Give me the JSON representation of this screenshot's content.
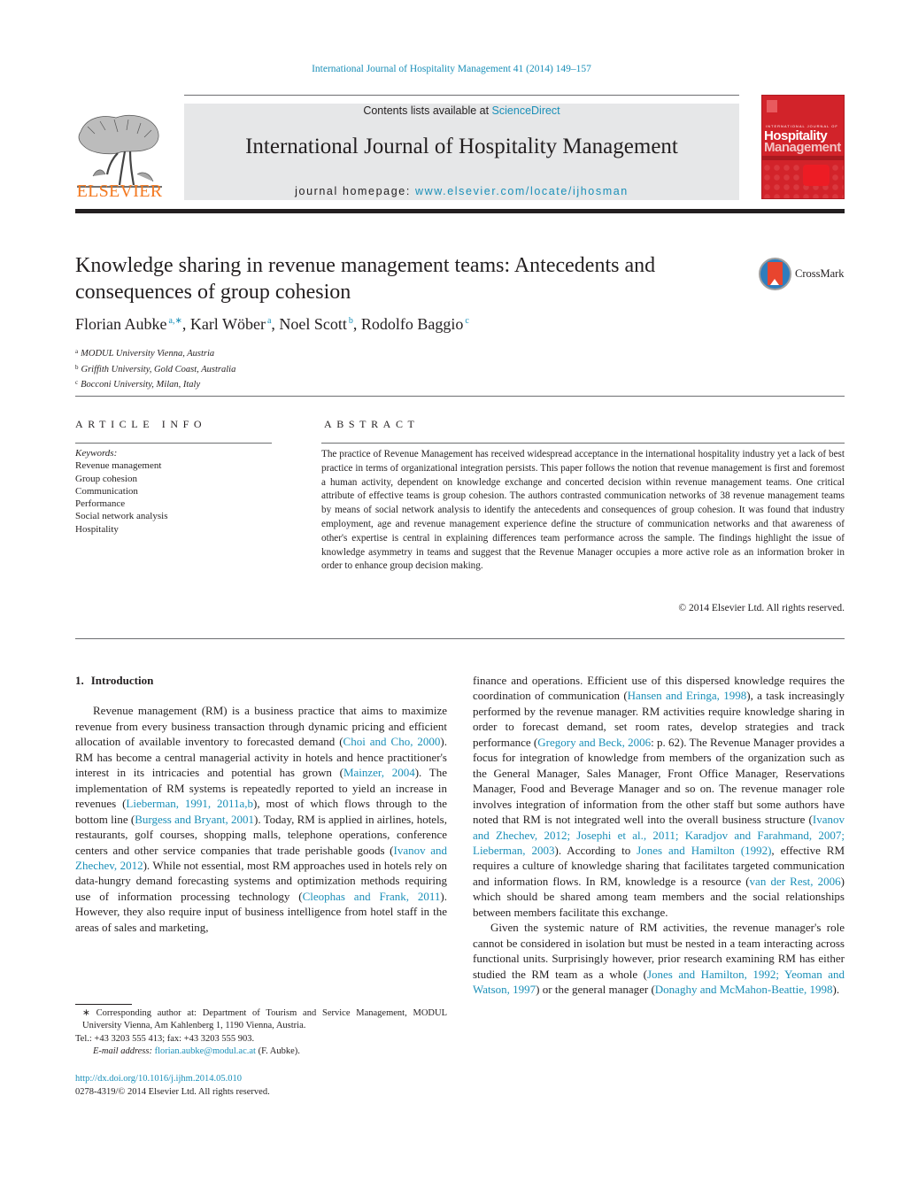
{
  "running_head": "International Journal of Hospitality Management 41 (2014) 149–157",
  "header": {
    "publisher_logo_text": "ELSEVIER",
    "contents_prefix": "Contents lists available at ",
    "contents_link": "ScienceDirect",
    "journal_title": "International Journal of Hospitality Management",
    "homepage_prefix": "journal homepage: ",
    "homepage_link": "www.elsevier.com/locate/ijhosman",
    "cover": {
      "small_line": "INTERNATIONAL JOURNAL OF",
      "big_line_1": "Hospitality",
      "big_line_2": "Management"
    }
  },
  "article": {
    "title": "Knowledge sharing in revenue management teams: Antecedents and consequences of group cohesion",
    "crossmark_label": "CrossMark",
    "authors": [
      {
        "name": "Florian Aubke",
        "sup": "a,∗"
      },
      {
        "name": "Karl Wöber",
        "sup": "a"
      },
      {
        "name": "Noel Scott",
        "sup": "b"
      },
      {
        "name": "Rodolfo Baggio",
        "sup": "c"
      }
    ],
    "affiliations": [
      {
        "key": "a",
        "text": "MODUL University Vienna, Austria"
      },
      {
        "key": "b",
        "text": "Griffith University, Gold Coast, Australia"
      },
      {
        "key": "c",
        "text": "Bocconi University, Milan, Italy"
      }
    ]
  },
  "article_info": {
    "heading": "ARTICLE INFO",
    "keywords_label": "Keywords:",
    "keywords": [
      "Revenue management",
      "Group cohesion",
      "Communication",
      "Performance",
      "Social network analysis",
      "Hospitality"
    ]
  },
  "abstract": {
    "heading": "ABSTRACT",
    "text": "The practice of Revenue Management has received widespread acceptance in the international hos­pitality industry yet a lack of best practice in terms of organizational integration persists. This paper follows the notion that revenue management is first and foremost a human activity, dependent on knowledge exchange and concerted decision within revenue management teams. One critical attribute of effective teams is group cohesion. The authors contrasted communication networks of 38 revenue management teams by means of social network analysis to identify the antecedents and consequences of group cohesion. It was found that industry employment, age and revenue management experience define the structure of communication networks and that awareness of other's expertise is central in explaining differences team performance across the sample. The findings highlight the issue of knowledge asymme­try in teams and suggest that the Revenue Manager occupies a more active role as an information broker in order to enhance group decision making.",
    "copyright": "© 2014 Elsevier Ltd. All rights reserved."
  },
  "body": {
    "section_number": "1.",
    "section_title": "Introduction",
    "left_paragraph": [
      {
        "t": "Revenue management (RM) is a business practice that aims to maximize revenue from every business transaction through dynamic pricing and efficient allocation of available inventory to forecasted demand ("
      },
      {
        "c": "Choi and Cho, 2000"
      },
      {
        "t": "). RM has become a central managerial activity in hotels and hence practitioner's interest in its intricacies and potential has grown ("
      },
      {
        "c": "Mainzer, 2004"
      },
      {
        "t": "). The implementation of RM systems is repeatedly reported to yield an increase in revenues ("
      },
      {
        "c": "Lieberman, 1991, 2011a,b"
      },
      {
        "t": "), most of which flows through to the bottom line ("
      },
      {
        "c": "Burgess and Bryant, 2001"
      },
      {
        "t": "). Today, RM is applied in airlines, hotels, restaurants, golf courses, shopping malls, telephone operations, conference centers and other service companies that trade perishable goods ("
      },
      {
        "c": "Ivanov and Zhechev, 2012"
      },
      {
        "t": "). While not essential, most RM approaches used in hotels rely on data-hungry demand forecasting systems and optimization methods requiring use of information processing technology ("
      },
      {
        "c": "Cleophas and Frank, 2011"
      },
      {
        "t": "). However, they also require input of business intelligence from hotel staff in the areas of sales and marketing,"
      }
    ],
    "right_paragraph_1": [
      {
        "t": "finance and operations. Efficient use of this dispersed knowledge requires the coordination of communication ("
      },
      {
        "c": "Hansen and Eringa, 1998"
      },
      {
        "t": "), a task increasingly performed by the revenue manager. RM activities require knowledge sharing in order to forecast demand, set room rates, develop strategies and track performance ("
      },
      {
        "c": "Gregory and Beck, 2006"
      },
      {
        "t": ": p. 62). The Revenue Manager provides a focus for integration of knowledge from members of the organization such as the General Manager, Sales Manager, Front Office Manager, Reservations Manager, Food and Beverage Manager and so on. The revenue manager role involves integration of information from the other staff but some authors have noted that RM is not integrated well into the overall business structure ("
      },
      {
        "c": "Ivanov and Zhechev, 2012; Josephi et al., 2011; Karadjov and Farahmand, 2007; Lieberman, 2003"
      },
      {
        "t": "). According to "
      },
      {
        "c": "Jones and Hamilton (1992)"
      },
      {
        "t": ", effective RM requires a culture of knowledge sharing that facilitates targeted communication and information flows. In RM, knowledge is a resource ("
      },
      {
        "c": "van der Rest, 2006"
      },
      {
        "t": ") which should be shared among team members and the social relationships between members facilitate this exchange."
      }
    ],
    "right_paragraph_2": [
      {
        "t": "Given the systemic nature of RM activities, the revenue manager's role cannot be considered in isolation but must be nested in a team interacting across functional units. Surprisingly however, prior research examining RM has either studied the RM team as a whole ("
      },
      {
        "c": "Jones and Hamilton, 1992; Yeoman and Watson, 1997"
      },
      {
        "t": ") or the general manager ("
      },
      {
        "c": "Donaghy and McMahon-Beattie, 1998"
      },
      {
        "t": ")."
      }
    ]
  },
  "footnotes": {
    "corresponding": "∗ Corresponding author at: Department of Tourism and Service Management, MODUL University Vienna, Am Kahlenberg 1, 1190 Vienna, Austria.",
    "phone": "Tel.: +43 3203 555 413; fax: +43 3203 555 903.",
    "email_label": "E-mail address:",
    "email": "florian.aubke@modul.ac.at",
    "email_suffix": " (F. Aubke).",
    "doi": "http://dx.doi.org/10.1016/j.ijhm.2014.05.010",
    "issn_line": "0278-4319/© 2014 Elsevier Ltd. All rights reserved."
  }
}
